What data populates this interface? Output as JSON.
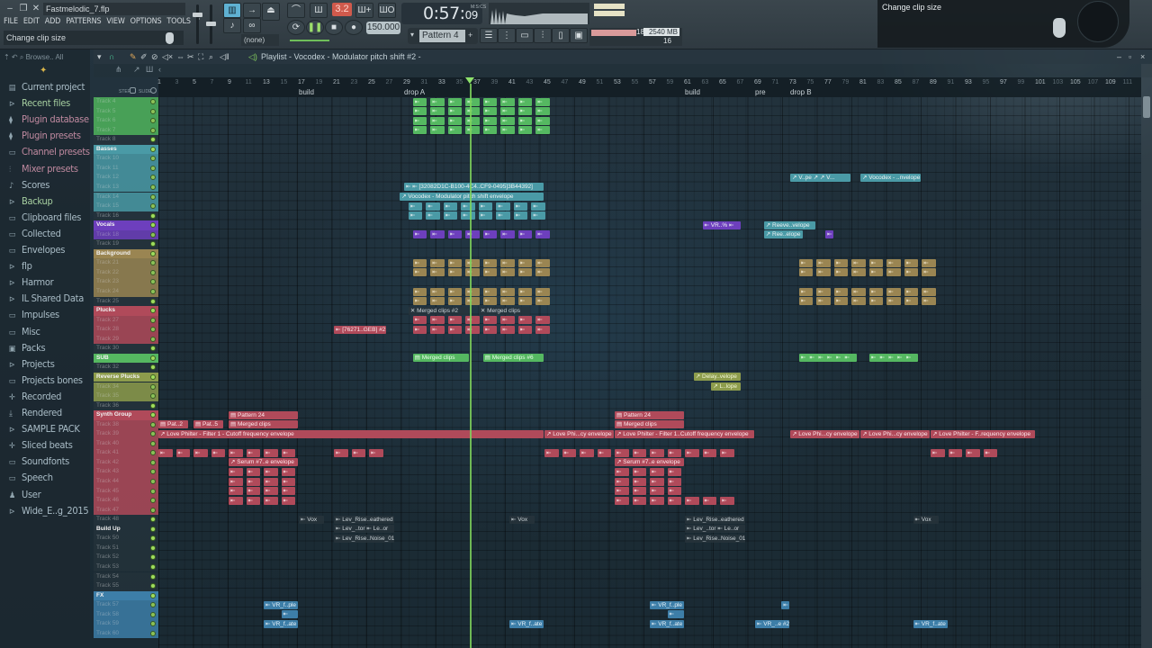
{
  "window": {
    "file_name": "Fastmelodic_7.flp",
    "controls": [
      "minimize",
      "restore",
      "close"
    ]
  },
  "menu": [
    "FILE",
    "EDIT",
    "ADD",
    "PATTERNS",
    "VIEW",
    "OPTIONS",
    "TOOLS",
    "?"
  ],
  "hint_bar": "Change clip size",
  "transport": {
    "song_position": "0:57",
    "song_position_sub": "09",
    "time_unit": "M:S:CS",
    "tempo": "150.000",
    "pattern": "Pattern 4",
    "snap": "(none)",
    "record_indicator": "3.2"
  },
  "monitor": {
    "cpu": "18",
    "memory": "2540 MB",
    "polyphony": "16"
  },
  "tooltip": {
    "text": "Change clip size"
  },
  "browser": {
    "toolbar": "Browse.. All",
    "items": [
      {
        "label": "Current project",
        "icon": "file-icon"
      },
      {
        "label": "Recent files",
        "icon": "folder-link-icon"
      },
      {
        "label": "Plugin database",
        "icon": "plug-icon"
      },
      {
        "label": "Plugin presets",
        "icon": "plug-icon"
      },
      {
        "label": "Channel presets",
        "icon": "channel-icon"
      },
      {
        "label": "Mixer presets",
        "icon": "mixer-icon"
      },
      {
        "label": "Scores",
        "icon": "note-icon"
      },
      {
        "label": "Backup",
        "icon": "folder-link-icon"
      },
      {
        "label": "Clipboard files",
        "icon": "folder-icon"
      },
      {
        "label": "Collected",
        "icon": "folder-icon"
      },
      {
        "label": "Envelopes",
        "icon": "folder-icon"
      },
      {
        "label": "flp",
        "icon": "folder-link-icon"
      },
      {
        "label": "Harmor",
        "icon": "folder-link-icon"
      },
      {
        "label": "IL Shared Data",
        "icon": "folder-link-icon"
      },
      {
        "label": "Impulses",
        "icon": "folder-icon"
      },
      {
        "label": "Misc",
        "icon": "folder-icon"
      },
      {
        "label": "Packs",
        "icon": "packs-icon"
      },
      {
        "label": "Projects",
        "icon": "folder-link-icon"
      },
      {
        "label": "Projects bones",
        "icon": "folder-icon"
      },
      {
        "label": "Recorded",
        "icon": "plus-icon"
      },
      {
        "label": "Rendered",
        "icon": "rendered-icon"
      },
      {
        "label": "SAMPLE PACK",
        "icon": "folder-link-icon"
      },
      {
        "label": "Sliced beats",
        "icon": "plus-icon"
      },
      {
        "label": "Soundfonts",
        "icon": "folder-icon"
      },
      {
        "label": "Speech",
        "icon": "folder-icon"
      },
      {
        "label": "User",
        "icon": "user-icon"
      },
      {
        "label": "Wide_E..g_2015",
        "icon": "folder-link-icon"
      }
    ]
  },
  "playlist": {
    "title": "Playlist - Vocodex - Modulator pitch shift #2 -",
    "step_label": "STEP",
    "slide_label": "SLIDE",
    "ruler_ticks": [
      1,
      3,
      5,
      7,
      9,
      11,
      13,
      15,
      17,
      19,
      21,
      23,
      25,
      27,
      29,
      31,
      33,
      35,
      37,
      39,
      41,
      43,
      45,
      47,
      49,
      51,
      53,
      55,
      57,
      59,
      61,
      63,
      65,
      67,
      69,
      71,
      73,
      75,
      77,
      79,
      81,
      83,
      85,
      87,
      89,
      91,
      93,
      95,
      97,
      99,
      101,
      103,
      105,
      107,
      109,
      111
    ],
    "markers": [
      {
        "bar": 17,
        "label": "build"
      },
      {
        "bar": 29,
        "label": "drop A"
      },
      {
        "bar": 61,
        "label": "build"
      },
      {
        "bar": 69,
        "label": "pre"
      },
      {
        "bar": 73,
        "label": "drop B"
      }
    ],
    "playhead_bar": 36.5,
    "tracks": [
      {
        "name": "Track 4",
        "color": "#4fb45c"
      },
      {
        "name": "Track 5",
        "color": "#4fb45c"
      },
      {
        "name": "Track 6",
        "color": "#4fb45c"
      },
      {
        "name": "Track 7",
        "color": "#4fb45c"
      },
      {
        "name": "Track 8",
        "color": ""
      },
      {
        "name": "Basses",
        "color": "#4a9aa6",
        "group": true
      },
      {
        "name": "Track 10",
        "color": "#4a9aa6"
      },
      {
        "name": "Track 11",
        "color": "#4a9aa6"
      },
      {
        "name": "Track 12",
        "color": "#4a9aa6"
      },
      {
        "name": "Track 13",
        "color": "#4a9aa6"
      },
      {
        "name": "Track 14",
        "color": "#4a9aa6"
      },
      {
        "name": "Track 15",
        "color": "#4a9aa6"
      },
      {
        "name": "Track 16",
        "color": ""
      },
      {
        "name": "Vocals",
        "color": "#6d3fbd",
        "group": true
      },
      {
        "name": "Track 18",
        "color": "#6d3fbd"
      },
      {
        "name": "Track 19",
        "color": ""
      },
      {
        "name": "Background",
        "color": "#9a8552",
        "group": true
      },
      {
        "name": "Track 21",
        "color": "#9a8552"
      },
      {
        "name": "Track 22",
        "color": "#9a8552"
      },
      {
        "name": "Track 23",
        "color": "#9a8552"
      },
      {
        "name": "Track 24",
        "color": "#9a8552"
      },
      {
        "name": "Track 25",
        "color": ""
      },
      {
        "name": "Plucks",
        "color": "#b04a5a",
        "group": true
      },
      {
        "name": "Track 27",
        "color": "#b04a5a"
      },
      {
        "name": "Track 28",
        "color": "#b04a5a"
      },
      {
        "name": "Track 29",
        "color": "#b04a5a"
      },
      {
        "name": "Track 30",
        "color": ""
      },
      {
        "name": "SUB",
        "color": "#55b861",
        "group": true
      },
      {
        "name": "Track 32",
        "color": ""
      },
      {
        "name": "Reverse Plucks",
        "color": "#8d9c4c",
        "group": true
      },
      {
        "name": "Track 34",
        "color": "#8d9c4c"
      },
      {
        "name": "Track 35",
        "color": "#8d9c4c"
      },
      {
        "name": "Track 36",
        "color": ""
      },
      {
        "name": "Synth Group",
        "color": "#b04a5a",
        "group": true
      },
      {
        "name": "Track 38",
        "color": "#b04a5a"
      },
      {
        "name": "Track 39",
        "color": "#b04a5a"
      },
      {
        "name": "Track 40",
        "color": "#b04a5a"
      },
      {
        "name": "Track 41",
        "color": "#b04a5a"
      },
      {
        "name": "Track 42",
        "color": "#b04a5a"
      },
      {
        "name": "Track 43",
        "color": "#b04a5a"
      },
      {
        "name": "Track 44",
        "color": "#b04a5a"
      },
      {
        "name": "Track 45",
        "color": "#b04a5a"
      },
      {
        "name": "Track 46",
        "color": "#b04a5a"
      },
      {
        "name": "Track 47",
        "color": "#b04a5a"
      },
      {
        "name": "Track 48",
        "color": ""
      },
      {
        "name": "Build Up",
        "color": "",
        "group": true
      },
      {
        "name": "Track 50",
        "color": ""
      },
      {
        "name": "Track 51",
        "color": ""
      },
      {
        "name": "Track 52",
        "color": ""
      },
      {
        "name": "Track 53",
        "color": ""
      },
      {
        "name": "Track 54",
        "color": ""
      },
      {
        "name": "Track 55",
        "color": ""
      },
      {
        "name": "FX",
        "color": "#3d7ea8",
        "group": true
      },
      {
        "name": "Track 57",
        "color": "#3d7ea8"
      },
      {
        "name": "Track 58",
        "color": "#3d7ea8"
      },
      {
        "name": "Track 59",
        "color": "#3d7ea8"
      },
      {
        "name": "Track 60",
        "color": "#3d7ea8"
      }
    ],
    "clips": [
      {
        "row": 9,
        "bar": 29,
        "len": 16,
        "cls": "c-teal",
        "label": "⇤ ⇤ [32082D1C-B100-4C4..CF9-0495]3B44392]"
      },
      {
        "row": 10,
        "bar": 28.5,
        "len": 16.5,
        "cls": "c-teal",
        "label": "↗ Vocodex - Modulator pitch shift envelope"
      },
      {
        "row": 8,
        "bar": 73,
        "len": 7,
        "cls": "c-teal",
        "label": "↗ V..pe ↗ ↗ V..."
      },
      {
        "row": 8,
        "bar": 81,
        "len": 7,
        "cls": "c-teal",
        "label": "↗ Vocodex - ..nvelope"
      },
      {
        "row": 13,
        "bar": 70,
        "len": 6,
        "cls": "c-teal",
        "label": "↗ Reeve..velope"
      },
      {
        "row": 14,
        "bar": 70,
        "len": 4.5,
        "cls": "c-teal",
        "label": "↗ Ree..elope"
      },
      {
        "row": 22,
        "bar": 29.5,
        "len": 7,
        "cls": "c-dark",
        "label": "✕ Merged clips #2"
      },
      {
        "row": 22,
        "bar": 37.5,
        "len": 6,
        "cls": "c-dark",
        "label": "✕ Merged clips"
      },
      {
        "row": 24,
        "bar": 21,
        "len": 6,
        "cls": "c-red",
        "label": "⇤ [76271..GEB] #2"
      },
      {
        "row": 27,
        "bar": 30,
        "len": 6.5,
        "cls": "c-green",
        "label": "▤ Merged clips"
      },
      {
        "row": 27,
        "bar": 38,
        "len": 7,
        "cls": "c-green",
        "label": "▤ Merged clips #6"
      },
      {
        "row": 29,
        "bar": 62,
        "len": 5.5,
        "cls": "c-olive",
        "label": "↗ Delay..velope"
      },
      {
        "row": 30,
        "bar": 64,
        "len": 3.5,
        "cls": "c-olive",
        "label": "↗ L..lope"
      },
      {
        "row": 33,
        "bar": 9,
        "len": 8,
        "cls": "c-red",
        "label": "▤ Pattern 24"
      },
      {
        "row": 34,
        "bar": 1,
        "len": 3.5,
        "cls": "c-red",
        "label": "▤ Pat..2"
      },
      {
        "row": 34,
        "bar": 5,
        "len": 3.5,
        "cls": "c-red",
        "label": "▤ Pat..5"
      },
      {
        "row": 34,
        "bar": 9,
        "len": 8,
        "cls": "c-red",
        "label": "▤ Merged clips"
      },
      {
        "row": 33,
        "bar": 53,
        "len": 8,
        "cls": "c-red",
        "label": "▤ Pattern 24"
      },
      {
        "row": 34,
        "bar": 53,
        "len": 8,
        "cls": "c-red",
        "label": "▤ Merged clips"
      },
      {
        "row": 35,
        "bar": 1,
        "len": 44,
        "cls": "c-red",
        "label": "↗ Love Philter - Filter 1 - Cutoff frequency envelope"
      },
      {
        "row": 35,
        "bar": 45,
        "len": 8,
        "cls": "c-red",
        "label": "↗ Love Phi...cy envelope"
      },
      {
        "row": 35,
        "bar": 53,
        "len": 16,
        "cls": "c-red",
        "label": "↗ Love Philter - Filter 1..Cutoff frequency envelope"
      },
      {
        "row": 35,
        "bar": 73,
        "len": 8,
        "cls": "c-red",
        "label": "↗ Love Phi...cy envelope"
      },
      {
        "row": 35,
        "bar": 81,
        "len": 8,
        "cls": "c-red",
        "label": "↗ Love Phi...cy envelope"
      },
      {
        "row": 35,
        "bar": 89,
        "len": 12,
        "cls": "c-red",
        "label": "↗ Love Philter - F..requency envelope"
      },
      {
        "row": 38,
        "bar": 9,
        "len": 8,
        "cls": "c-red",
        "label": "↗ Serum #7..e envelope"
      },
      {
        "row": 38,
        "bar": 53,
        "len": 8,
        "cls": "c-red",
        "label": "↗ Serum #7..e envelope"
      },
      {
        "row": 44,
        "bar": 17,
        "len": 3,
        "cls": "c-dark",
        "label": "⇤ Vox"
      },
      {
        "row": 44,
        "bar": 21,
        "len": 7,
        "cls": "c-dark",
        "label": "⇤ Lev_Rise..eathered"
      },
      {
        "row": 45,
        "bar": 21,
        "len": 7,
        "cls": "c-dark",
        "label": "⇤ Lev_..tor ⇤ Le..or"
      },
      {
        "row": 46,
        "bar": 21,
        "len": 7,
        "cls": "c-dark",
        "label": "⇤ Lev_Rise..Noise_01"
      },
      {
        "row": 44,
        "bar": 41,
        "len": 3,
        "cls": "c-dark",
        "label": "⇤ Vox"
      },
      {
        "row": 44,
        "bar": 61,
        "len": 7,
        "cls": "c-dark",
        "label": "⇤ Lev_Rise..eathered"
      },
      {
        "row": 45,
        "bar": 61,
        "len": 7,
        "cls": "c-dark",
        "label": "⇤ Lev_..tor ⇤ Le..or"
      },
      {
        "row": 46,
        "bar": 61,
        "len": 7,
        "cls": "c-dark",
        "label": "⇤ Lev_Rise..Noise_01"
      },
      {
        "row": 44,
        "bar": 87,
        "len": 3,
        "cls": "c-dark",
        "label": "⇤ Vox"
      },
      {
        "row": 53,
        "bar": 13,
        "len": 4,
        "cls": "c-blue",
        "label": "⇤ VR_f..ple"
      },
      {
        "row": 54,
        "bar": 15,
        "len": 2,
        "cls": "c-blue",
        "label": "⇤"
      },
      {
        "row": 55,
        "bar": 13,
        "len": 4,
        "cls": "c-blue",
        "label": "⇤ VR_f..ate"
      },
      {
        "row": 55,
        "bar": 41,
        "len": 4,
        "cls": "c-blue",
        "label": "⇤ VR_f..ate"
      },
      {
        "row": 53,
        "bar": 57,
        "len": 4,
        "cls": "c-blue",
        "label": "⇤ VR_f..ple"
      },
      {
        "row": 54,
        "bar": 59,
        "len": 2,
        "cls": "c-blue",
        "label": "⇤"
      },
      {
        "row": 55,
        "bar": 57,
        "len": 4,
        "cls": "c-blue",
        "label": "⇤ VR_f..ate"
      },
      {
        "row": 53,
        "bar": 72,
        "len": 1,
        "cls": "c-blue",
        "label": "⇤"
      },
      {
        "row": 55,
        "bar": 69,
        "len": 4,
        "cls": "c-blue",
        "label": "⇤ VR_..e #2"
      },
      {
        "row": 55,
        "bar": 87,
        "len": 4,
        "cls": "c-blue",
        "label": "⇤ VR_f..ate"
      },
      {
        "row": 14,
        "bar": 77,
        "len": 1,
        "cls": "c-purple",
        "label": "⇤"
      },
      {
        "row": 13,
        "bar": 63,
        "len": 4.5,
        "cls": "c-purple",
        "label": "⇤ VR..% ⇤"
      }
    ]
  }
}
